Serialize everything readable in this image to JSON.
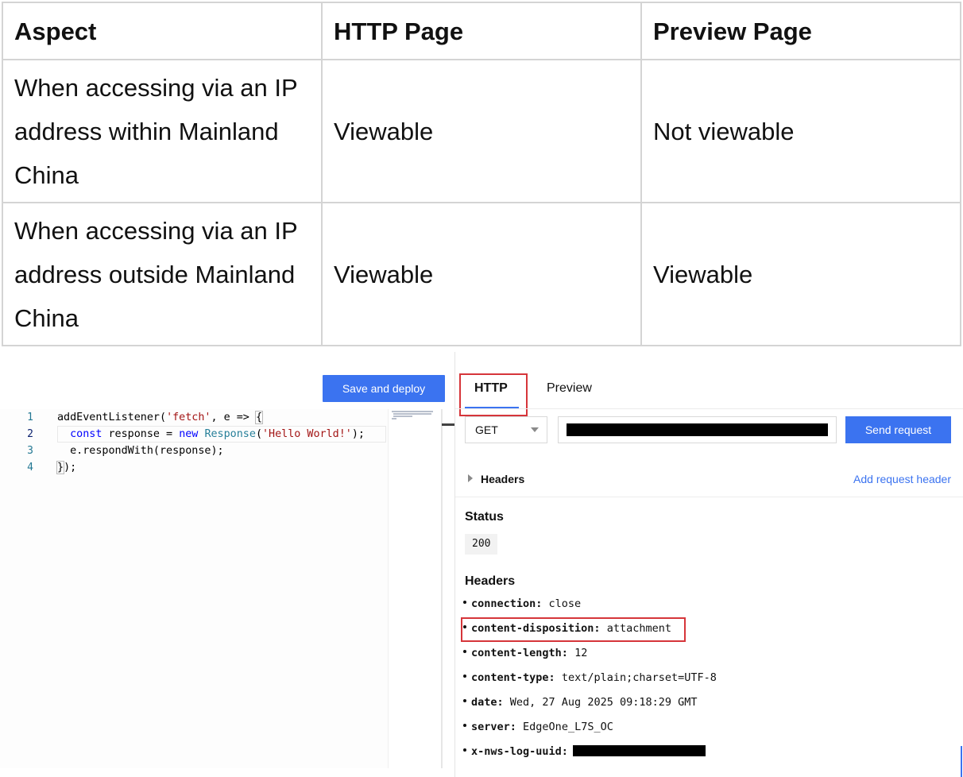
{
  "table": {
    "headers": [
      "Aspect",
      "HTTP Page",
      "Preview Page"
    ],
    "rows": [
      [
        "When accessing via an IP address within Mainland China",
        "Viewable",
        "Not viewable"
      ],
      [
        "When accessing via an IP address outside Mainland China",
        "Viewable",
        "Viewable"
      ]
    ]
  },
  "editor": {
    "deploy_label": "Save and deploy",
    "line_numbers": [
      "1",
      "2",
      "3",
      "4"
    ]
  },
  "http_panel": {
    "tabs": [
      "HTTP",
      "Preview"
    ],
    "active_tab": "HTTP",
    "method": "GET",
    "send_label": "Send request",
    "headers_toggle_label": "Headers",
    "add_header_label": "Add request header",
    "status_title": "Status",
    "status_code": "200",
    "response_headers_title": "Headers",
    "response_headers": [
      {
        "key": "connection:",
        "value": "close"
      },
      {
        "key": "content-disposition:",
        "value": "attachment"
      },
      {
        "key": "content-length:",
        "value": "12"
      },
      {
        "key": "content-type:",
        "value": "text/plain;charset=UTF-8"
      },
      {
        "key": "date:",
        "value": "Wed, 27 Aug 2025 09:18:29 GMT"
      },
      {
        "key": "server:",
        "value": "EdgeOne_L7S_OC"
      },
      {
        "key": "x-nws-log-uuid:",
        "value": ""
      }
    ]
  },
  "colors": {
    "accent": "#3b73f0",
    "highlight": "#d6353a"
  }
}
